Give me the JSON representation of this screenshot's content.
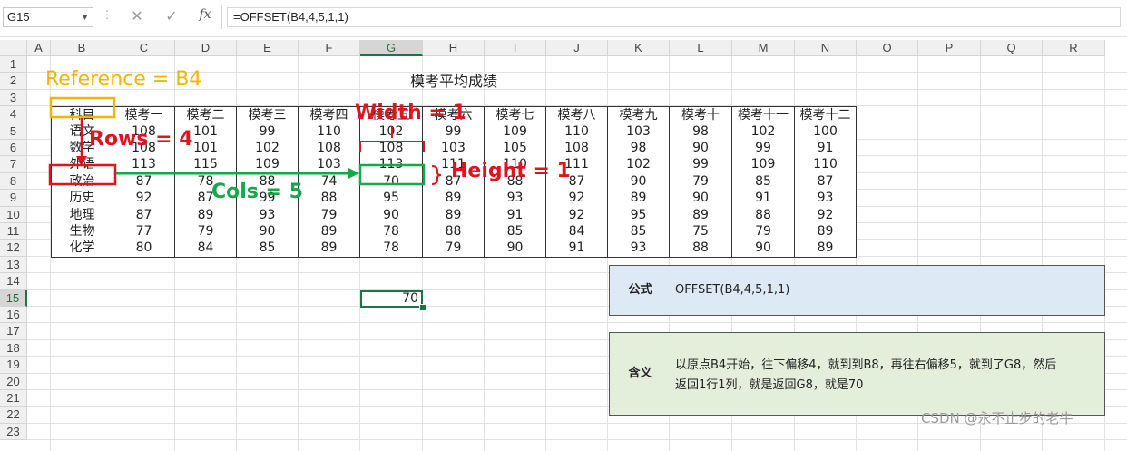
{
  "formula_bar": {
    "name_box": "G15",
    "formula": "=OFFSET(B4,4,5,1,1)"
  },
  "columns": [
    "A",
    "B",
    "C",
    "D",
    "E",
    "F",
    "G",
    "H",
    "I",
    "J",
    "K",
    "L",
    "M",
    "N",
    "O",
    "P",
    "Q",
    "R"
  ],
  "selected_column": "G",
  "rows": [
    "1",
    "2",
    "3",
    "4",
    "5",
    "6",
    "7",
    "8",
    "9",
    "10",
    "11",
    "12",
    "13",
    "14",
    "15",
    "16",
    "17",
    "18",
    "19",
    "20",
    "21",
    "22",
    "23"
  ],
  "selected_row": "15",
  "table": {
    "title": "模考平均成绩",
    "header": [
      "科目",
      "模考一",
      "模考二",
      "模考三",
      "模考四",
      "模考五",
      "模考六",
      "模考七",
      "模考八",
      "模考九",
      "模考十",
      "模考十一",
      "模考十二"
    ],
    "body": [
      [
        "语文",
        "108",
        "101",
        "99",
        "110",
        "102",
        "99",
        "109",
        "110",
        "103",
        "98",
        "102",
        "100"
      ],
      [
        "数学",
        "108",
        "101",
        "102",
        "108",
        "108",
        "103",
        "105",
        "108",
        "98",
        "90",
        "99",
        "91"
      ],
      [
        "外语",
        "113",
        "115",
        "109",
        "103",
        "113",
        "111",
        "110",
        "111",
        "102",
        "99",
        "109",
        "110"
      ],
      [
        "政治",
        "87",
        "78",
        "88",
        "74",
        "70",
        "87",
        "88",
        "87",
        "90",
        "79",
        "85",
        "87"
      ],
      [
        "历史",
        "92",
        "87",
        "99",
        "88",
        "95",
        "89",
        "93",
        "92",
        "89",
        "90",
        "91",
        "93"
      ],
      [
        "地理",
        "87",
        "89",
        "93",
        "79",
        "90",
        "89",
        "91",
        "92",
        "95",
        "89",
        "88",
        "92"
      ],
      [
        "生物",
        "77",
        "79",
        "90",
        "89",
        "78",
        "88",
        "85",
        "84",
        "85",
        "75",
        "79",
        "89"
      ],
      [
        "化学",
        "80",
        "84",
        "85",
        "89",
        "78",
        "79",
        "90",
        "91",
        "93",
        "88",
        "90",
        "89"
      ]
    ]
  },
  "result_cell": "70",
  "info": {
    "formula_label": "公式",
    "formula_value": "OFFSET(B4,4,5,1,1)",
    "meaning_label": "含义",
    "meaning_line1": "以原点B4开始，往下偏移4，就到到B8，再往右偏移5，就到了G8，然后",
    "meaning_line2": "返回1行1列，就是返回G8，就是70"
  },
  "annotations": {
    "reference": "Reference = B4",
    "rows": "Rows = 4",
    "cols": "Cols = 5",
    "width": "Width = 1",
    "height": "Height = 1"
  },
  "watermark": "CSDN @永不止步的老牛",
  "colors": {
    "reference": "#f5b400",
    "red": "#e0141e",
    "green": "#15a84a",
    "excel_green": "#217346",
    "formula_box_bg": "#dde9f5",
    "meaning_box_bg": "#e3eedb"
  }
}
